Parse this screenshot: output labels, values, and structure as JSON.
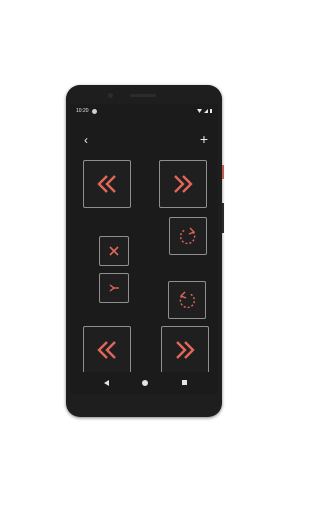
{
  "status_bar": {
    "time": "10:20"
  },
  "toolbar": {
    "back_icon": "chevron-left-icon",
    "add_icon": "plus-icon"
  },
  "controls": [
    {
      "name": "rewind-button-top",
      "icon": "double-chevron-left-icon"
    },
    {
      "name": "fast-forward-button-top",
      "icon": "double-chevron-right-icon"
    },
    {
      "name": "rotate-clockwise-button",
      "icon": "rotate-clockwise-icon"
    },
    {
      "name": "close-button",
      "icon": "x-icon"
    },
    {
      "name": "merge-button",
      "icon": "y-arrow-icon"
    },
    {
      "name": "rotate-counterclockwise-button",
      "icon": "rotate-counterclockwise-icon"
    },
    {
      "name": "rewind-button-bottom",
      "icon": "double-chevron-left-icon"
    },
    {
      "name": "fast-forward-button-bottom",
      "icon": "double-chevron-right-icon"
    }
  ],
  "colors": {
    "accent": "#e0675a",
    "button_border": "#8f8f8f",
    "screen_bg": "#1b1b1b"
  },
  "nav_bar": [
    "back-triangle-icon",
    "home-circle-icon",
    "recents-square-icon"
  ]
}
